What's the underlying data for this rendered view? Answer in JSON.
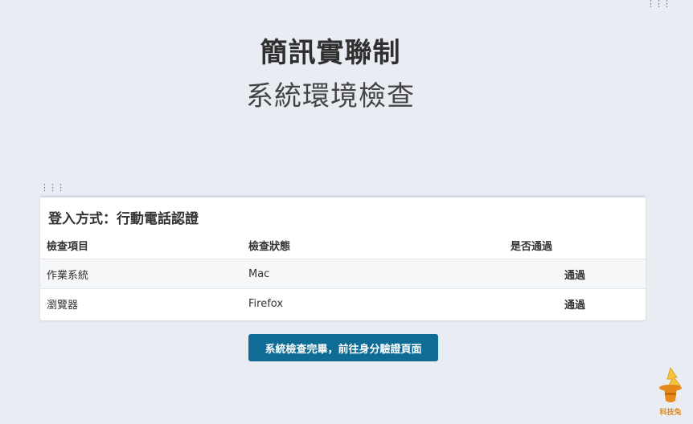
{
  "header": {
    "title": "簡訊實聯制",
    "subtitle": "系統環境檢查"
  },
  "panel": {
    "heading": "登入方式：行動電話認證",
    "columns": [
      "檢查項目",
      "檢查狀態",
      "是否通過"
    ],
    "rows": [
      {
        "item": "作業系統",
        "status": "Mac",
        "result": "通過"
      },
      {
        "item": "瀏覽器",
        "status": "Firefox",
        "result": "通過"
      }
    ]
  },
  "actions": {
    "proceed_label": "系統檢查完畢，前往身分驗證頁面"
  },
  "logo": {
    "text": "科技兔",
    "icon": "rabbit-hat-icon"
  },
  "colors": {
    "background": "#e9edf3",
    "button": "#0f6c95",
    "pass": "#1f9d55",
    "logo": "#e58a1a"
  }
}
